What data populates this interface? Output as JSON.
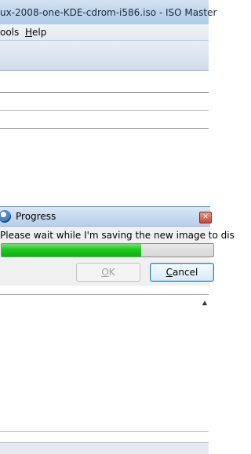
{
  "window": {
    "title": "ux-2008-one-KDE-cdrom-i586.iso - ISO Master"
  },
  "menubar": {
    "tools_prefix": "o",
    "tools_underlined": "",
    "tools_rest": "ols",
    "help_underlined": "H",
    "help_rest": "elp"
  },
  "dialog": {
    "title": "Progress",
    "message": "Please wait while I'm saving the new image to dis",
    "progress": 0.66,
    "ok_underlined": "O",
    "ok_rest": "K",
    "cancel_underlined": "C",
    "cancel_rest": "ancel",
    "close_glyph": "✕"
  },
  "file_pane": {
    "sort_glyph": "▲"
  },
  "colors": {
    "progress_fill": "#1ec81e",
    "titlebar": "#bcd3ec"
  }
}
